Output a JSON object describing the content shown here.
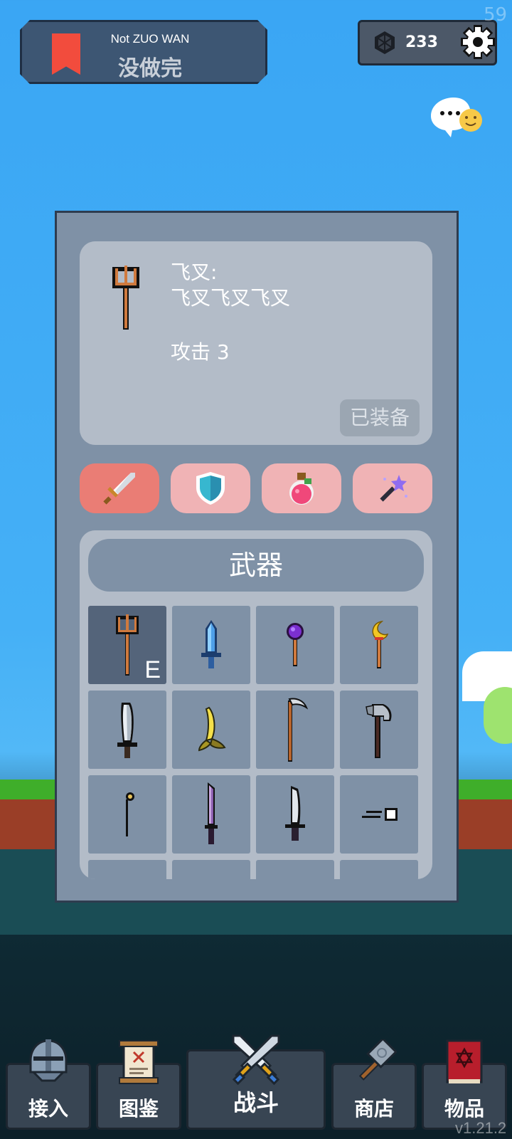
{
  "header": {
    "title_en": "Not ZUO WAN",
    "title_cn": "没做完",
    "currency_icon": "hexagon-gem-icon",
    "currency_count": "233",
    "settings_icon": "gear-icon",
    "fps": "59"
  },
  "chat": {
    "icon": "chat-bubble-emoji-icon",
    "bubble_text": "•••"
  },
  "detail": {
    "icon": "trident-icon",
    "name": "飞叉:",
    "description": "飞叉飞叉飞叉",
    "attack": "攻击 3",
    "equipped_label": "已装备"
  },
  "categories": [
    {
      "icon": "sword-icon",
      "active": true
    },
    {
      "icon": "shield-icon",
      "active": false
    },
    {
      "icon": "potion-icon",
      "active": false
    },
    {
      "icon": "magic-wand-icon",
      "active": false
    }
  ],
  "inventory": {
    "title": "武器",
    "items": [
      {
        "icon": "trident-icon",
        "badge": "E"
      },
      {
        "icon": "ice-sword-icon"
      },
      {
        "icon": "purple-orb-staff-icon"
      },
      {
        "icon": "crescent-staff-icon"
      },
      {
        "icon": "cleaver-icon"
      },
      {
        "icon": "banana-icon"
      },
      {
        "icon": "scythe-icon"
      },
      {
        "icon": "axe-icon"
      },
      {
        "icon": "thin-wand-icon"
      },
      {
        "icon": "purple-sword-icon"
      },
      {
        "icon": "long-knife-icon"
      },
      {
        "icon": "dart-icon"
      }
    ]
  },
  "nav": [
    {
      "label": "接入",
      "icon": "knight-helmet-icon"
    },
    {
      "label": "图鉴",
      "icon": "scroll-icon"
    },
    {
      "label": "战斗",
      "icon": "crossed-swords-icon"
    },
    {
      "label": "商店",
      "icon": "hammer-icon"
    },
    {
      "label": "物品",
      "icon": "spellbook-icon"
    }
  ],
  "version": "v1.21.2",
  "colors": {
    "sky": "#3aa6f4",
    "panel": "#7f91a6",
    "panel_light": "#b3bcc8",
    "category_active": "#ea7d75",
    "category_inactive": "#f0b3b5",
    "bookmark": "#f24c3d"
  }
}
